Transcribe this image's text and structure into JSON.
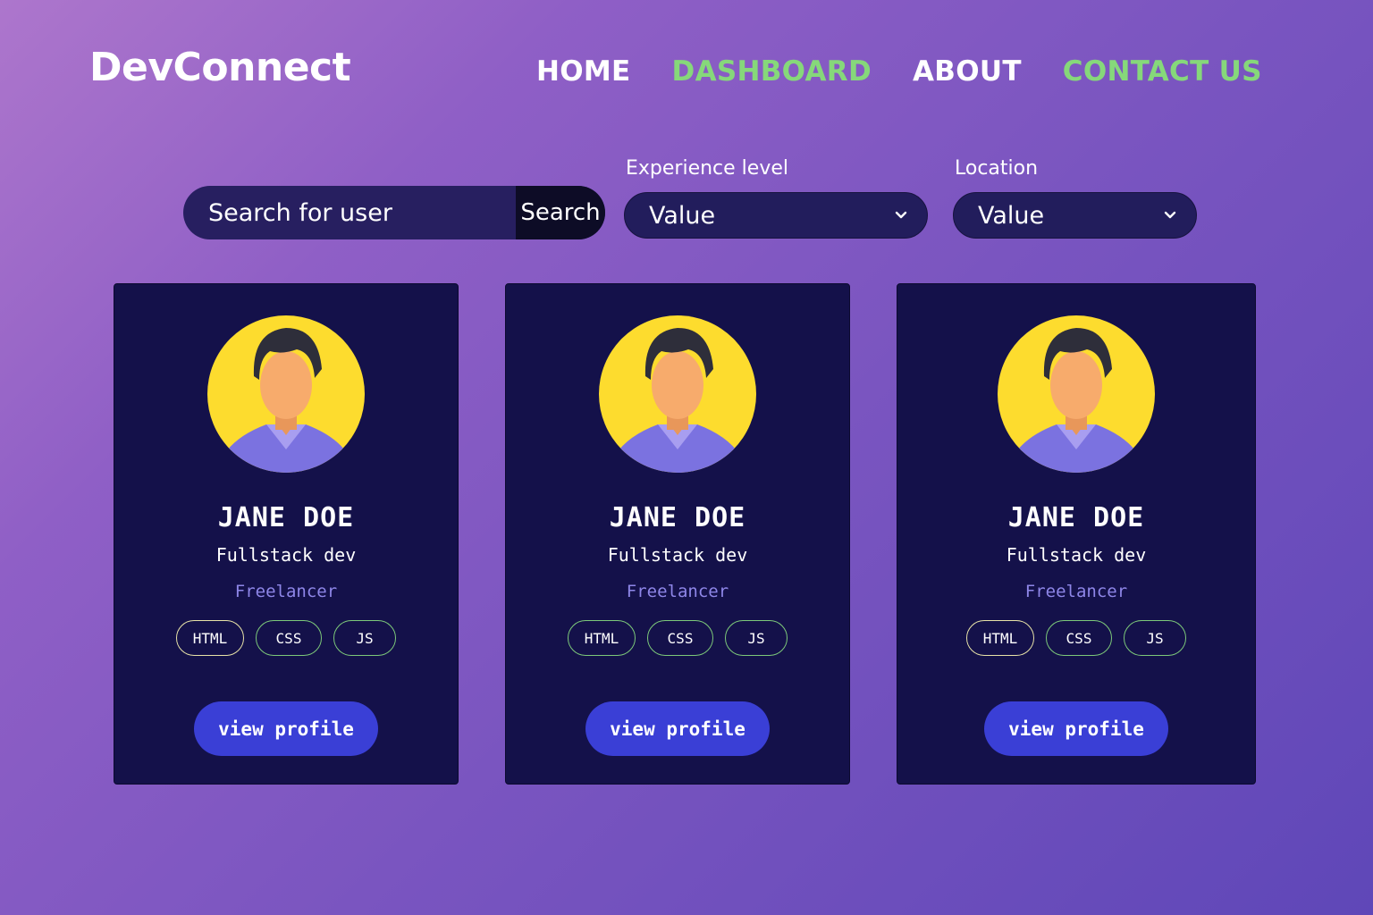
{
  "header": {
    "logo": "DevConnect",
    "nav": [
      {
        "label": "HOME",
        "color": "#ffffff"
      },
      {
        "label": "DASHBOARD",
        "color": "#86d87a"
      },
      {
        "label": "ABOUT",
        "color": "#ffffff"
      },
      {
        "label": "CONTACT US",
        "color": "#86d87a"
      }
    ]
  },
  "search": {
    "placeholder": "Search for user",
    "button_label": "Search"
  },
  "filters": {
    "experience": {
      "label": "Experience level",
      "value": "Value"
    },
    "location": {
      "label": "Location",
      "value": "Value"
    }
  },
  "cards": [
    {
      "name": "JANE DOE",
      "role": "Fullstack dev",
      "status": "Freelancer",
      "tags": [
        "HTML",
        "CSS",
        "JS"
      ],
      "button_label": "view profile"
    },
    {
      "name": "JANE DOE",
      "role": "Fullstack dev",
      "status": "Freelancer",
      "tags": [
        "HTML",
        "CSS",
        "JS"
      ],
      "button_label": "view profile"
    },
    {
      "name": "JANE DOE",
      "role": "Fullstack dev",
      "status": "Freelancer",
      "tags": [
        "HTML",
        "CSS",
        "JS"
      ],
      "button_label": "view profile"
    }
  ],
  "colors": {
    "accent_green": "#86d87a",
    "card_bg": "#14114a",
    "button_blue": "#3a3fd6",
    "avatar_yellow": "#fddc2e",
    "freelancer_purple": "#8e86e8"
  },
  "icons": {
    "dropdown": "chevron-down-icon",
    "avatar": "user-avatar-icon"
  }
}
